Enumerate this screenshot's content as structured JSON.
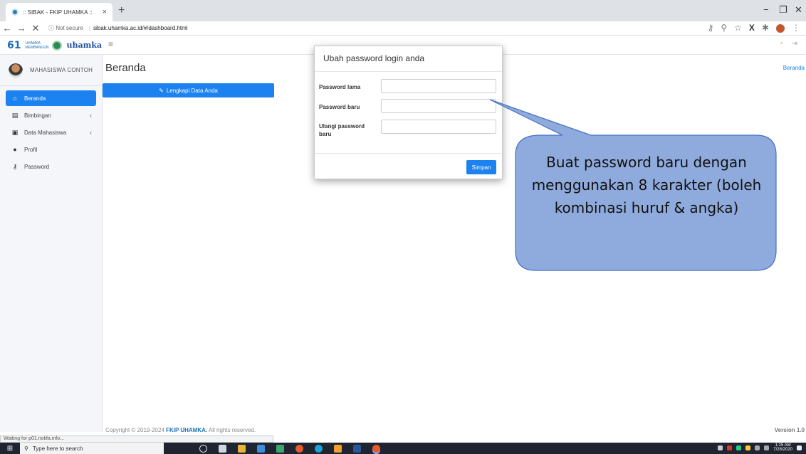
{
  "browser": {
    "tab_title": ":: SIBAK - FKIP UHAMKA ::",
    "tab_close": "×",
    "new_tab": "+",
    "nav_back": "←",
    "nav_forward": "→",
    "nav_stop": "✕",
    "security_label": "ⓘ Not secure",
    "url": "sibak.uhamka.ac.id/#/dashboard.html",
    "win_minimize": "−",
    "win_restore": "❐",
    "win_close": "✕",
    "status_text": "Waiting for p01.notifa.info..."
  },
  "header": {
    "logo_number": "61",
    "logo_tagline": "UHAMKA MEMBANGUN",
    "logo_wordmark": "uhamka",
    "menu_toggle": "≡"
  },
  "sidebar": {
    "user_name": "MAHASISWA CONTOH",
    "items": [
      {
        "label": "Beranda",
        "icon": "home-icon",
        "active": true
      },
      {
        "label": "Bimbingan",
        "icon": "book-icon",
        "has_submenu": true
      },
      {
        "label": "Data Mahasiswa",
        "icon": "id-card-icon",
        "has_submenu": true
      },
      {
        "label": "Profil",
        "icon": "user-icon"
      },
      {
        "label": "Password",
        "icon": "key-icon"
      }
    ]
  },
  "main": {
    "page_title": "Beranda",
    "breadcrumb": "Beranda",
    "cta_label": "Lengkapi Data Anda"
  },
  "modal": {
    "title": "Ubah password login anda",
    "fields": [
      {
        "label": "Password lama",
        "value": ""
      },
      {
        "label": "Password baru",
        "value": ""
      },
      {
        "label": "Ulangi password baru",
        "value": ""
      }
    ],
    "save_label": "Simpan"
  },
  "callout": {
    "text": "Buat password baru dengan menggunakan 8 karakter (boleh kombinasi huruf & angka)"
  },
  "footer": {
    "copyright_prefix": "Copyright © 2019-2024 ",
    "copyright_org": "FKIP UHAMKA.",
    "copyright_suffix": " All rights reserved.",
    "version": "Version 1.0"
  },
  "taskbar": {
    "search_placeholder": "Type here to search",
    "clock_time": "1:25 AM",
    "clock_date": "7/28/2020"
  },
  "colors": {
    "primary": "#1c82f0",
    "callout_fill": "#8faadc",
    "callout_stroke": "#4472c4"
  }
}
